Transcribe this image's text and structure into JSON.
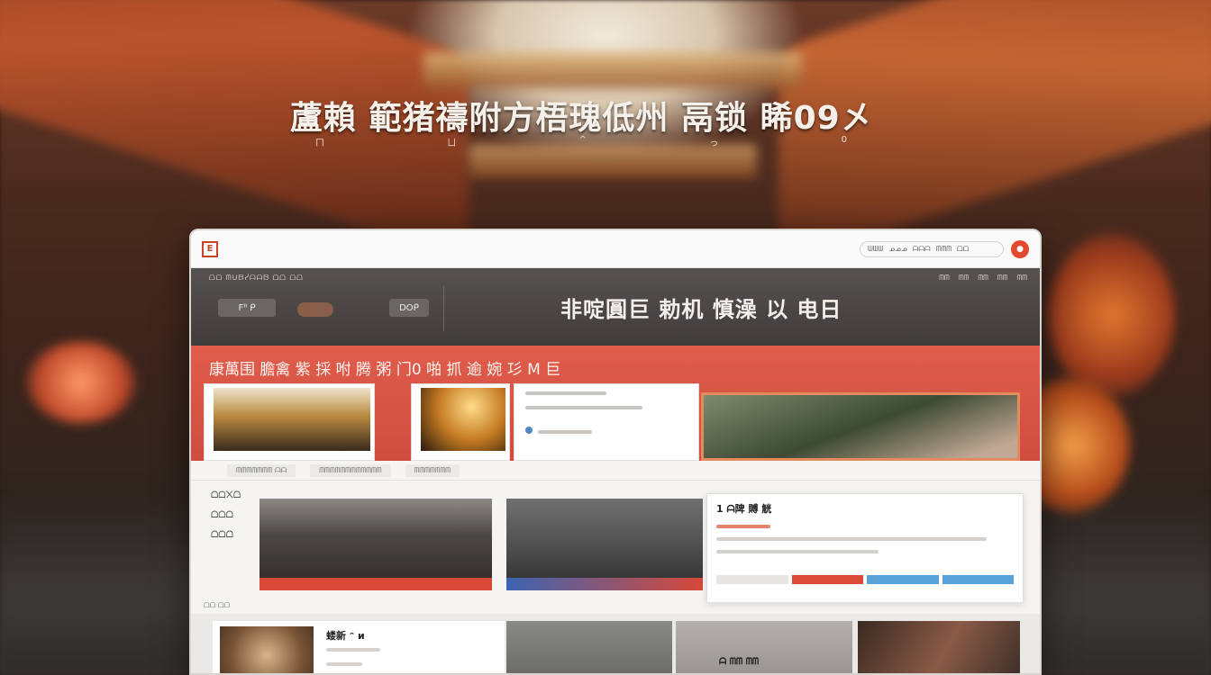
{
  "headline": "蘆賴 範猪禱附方梧瑰低州 鬲锁  睎09㐅",
  "subline": [
    "ㄇ",
    "ㄩ",
    "^",
    "っ",
    "0"
  ],
  "topbar": {
    "logo": "E",
    "search_items": [
      "ᗯᗯᗯ",
      "ᓄᓄᓄ",
      "ᗩᗩᗩ",
      "ᗰᗰᗰ",
      "ᗝᗝ"
    ],
    "avatar": "●"
  },
  "hero": {
    "top_text": "ᗝᗝ ᗰᑌᗷᓰᗩᗩᗷ ᗝᗝ ᗝᗝ",
    "nav": [
      "ᗰᗰ",
      "ᗰᗰ",
      "ᗰᗰ",
      "ᗰᗰ",
      "ᗰᗰ"
    ],
    "button1": "Fᐦ ᑭ",
    "button2": "DOᑭ",
    "title": "非啶圓巨 勅机 慎澡 以 电日"
  },
  "banner": {
    "title": "康萬围 膽禽 紫 採 咐 腾 粥 门0 啪 抓 逾 婉 㣉 M 巨"
  },
  "strip": [
    "ᗰᗰᗰᗰᗰᗰᗰ  ᗩᗩ",
    "ᗰᗰᗰᗰᗰᗰᗰᗰᗰᗰᗰᗰ",
    "ᗰᗰᗰᗰᗰᗰᗰ"
  ],
  "row1": {
    "side_labels": [
      "ᗝᗝ᙭ᗝ",
      "ᗝᗝᗝ",
      "ᗝᗝᗝ"
    ],
    "info_title": "1 ᗩ陴 賻 觥",
    "foot": "ᗝᗝ ᗝᗝ"
  },
  "row2": {
    "card1_title": "蝼新 ᵔ ᴎ",
    "card3_title": "ᗩ ᗰᗰ ᗰᗰ"
  }
}
